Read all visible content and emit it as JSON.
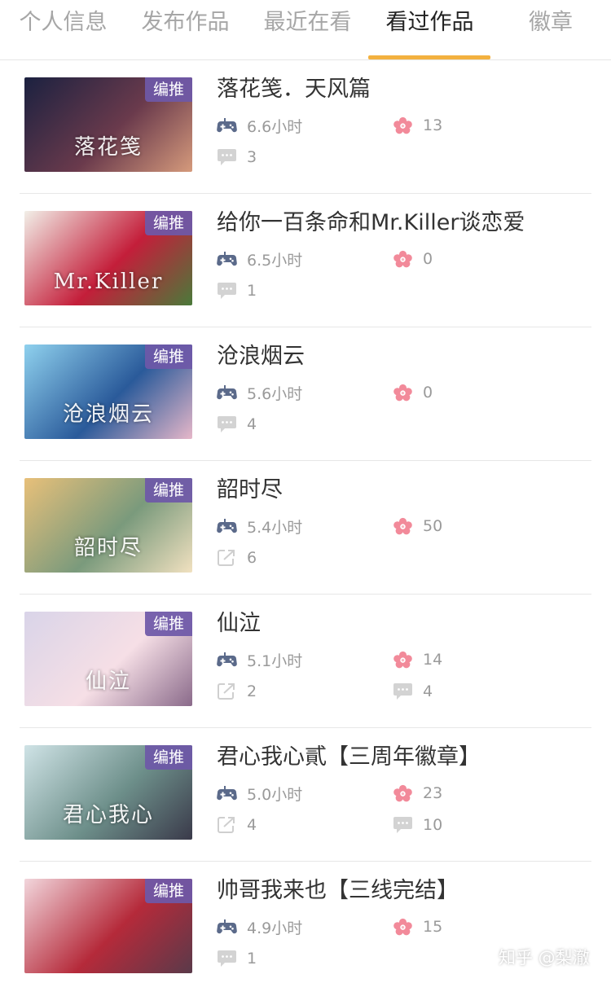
{
  "tabs": [
    {
      "label": "个人信息",
      "active": false
    },
    {
      "label": "发布作品",
      "active": false
    },
    {
      "label": "最近在看",
      "active": false
    },
    {
      "label": "看过作品",
      "active": true
    },
    {
      "label": "徽章",
      "active": false
    }
  ],
  "badge_label": "编推",
  "items": [
    {
      "title": "落花笺．天风篇",
      "thumb_text": "落花笺",
      "playtime": "6.6小时",
      "flowers": "13",
      "comments": "3",
      "shares": null,
      "colors": [
        "#1b2140",
        "#6a3a4c",
        "#d59a7c"
      ]
    },
    {
      "title": "给你一百条命和Mr.Killer谈恋爱",
      "thumb_text": "Mr.Killer",
      "playtime": "6.5小时",
      "flowers": "0",
      "comments": "1",
      "shares": null,
      "colors": [
        "#f2efe8",
        "#c41e3a",
        "#4a7a3a"
      ]
    },
    {
      "title": "沧浪烟云",
      "thumb_text": "沧浪烟云",
      "playtime": "5.6小时",
      "flowers": "0",
      "comments": "4",
      "shares": null,
      "colors": [
        "#8fd1ee",
        "#2a5a9a",
        "#e6b7c9"
      ]
    },
    {
      "title": "韶时尽",
      "thumb_text": "韶时尽",
      "playtime": "5.4小时",
      "flowers": "50",
      "comments": null,
      "shares": "6",
      "colors": [
        "#e8c07a",
        "#7a9a7c",
        "#f1e1c0"
      ]
    },
    {
      "title": "仙泣",
      "thumb_text": "仙泣",
      "playtime": "5.1小时",
      "flowers": "14",
      "comments": "4",
      "shares": "2",
      "colors": [
        "#d9d4e8",
        "#f6dfe6",
        "#8a6a8a"
      ]
    },
    {
      "title": "君心我心貳【三周年徽章】",
      "thumb_text": "君心我心",
      "playtime": "5.0小时",
      "flowers": "23",
      "comments": "10",
      "shares": "4",
      "colors": [
        "#cfe3e6",
        "#6d8f8a",
        "#3a3a4a"
      ]
    },
    {
      "title": "帅哥我来也【三线完结】",
      "thumb_text": "",
      "playtime": "4.9小时",
      "flowers": "15",
      "comments": "1",
      "shares": null,
      "colors": [
        "#f2d6dc",
        "#b52a3a",
        "#5a3a4a"
      ]
    }
  ],
  "icons": {
    "playtime": "gamepad-icon",
    "flowers": "flower-icon",
    "comments": "comment-icon",
    "shares": "share-icon"
  },
  "icon_colors": {
    "gamepad": "#5b6a8a",
    "flower": "#f28a9a",
    "muted": "#cfcfcf"
  },
  "accent_color": "#f3b13f",
  "watermark": "知乎 @梨澈"
}
